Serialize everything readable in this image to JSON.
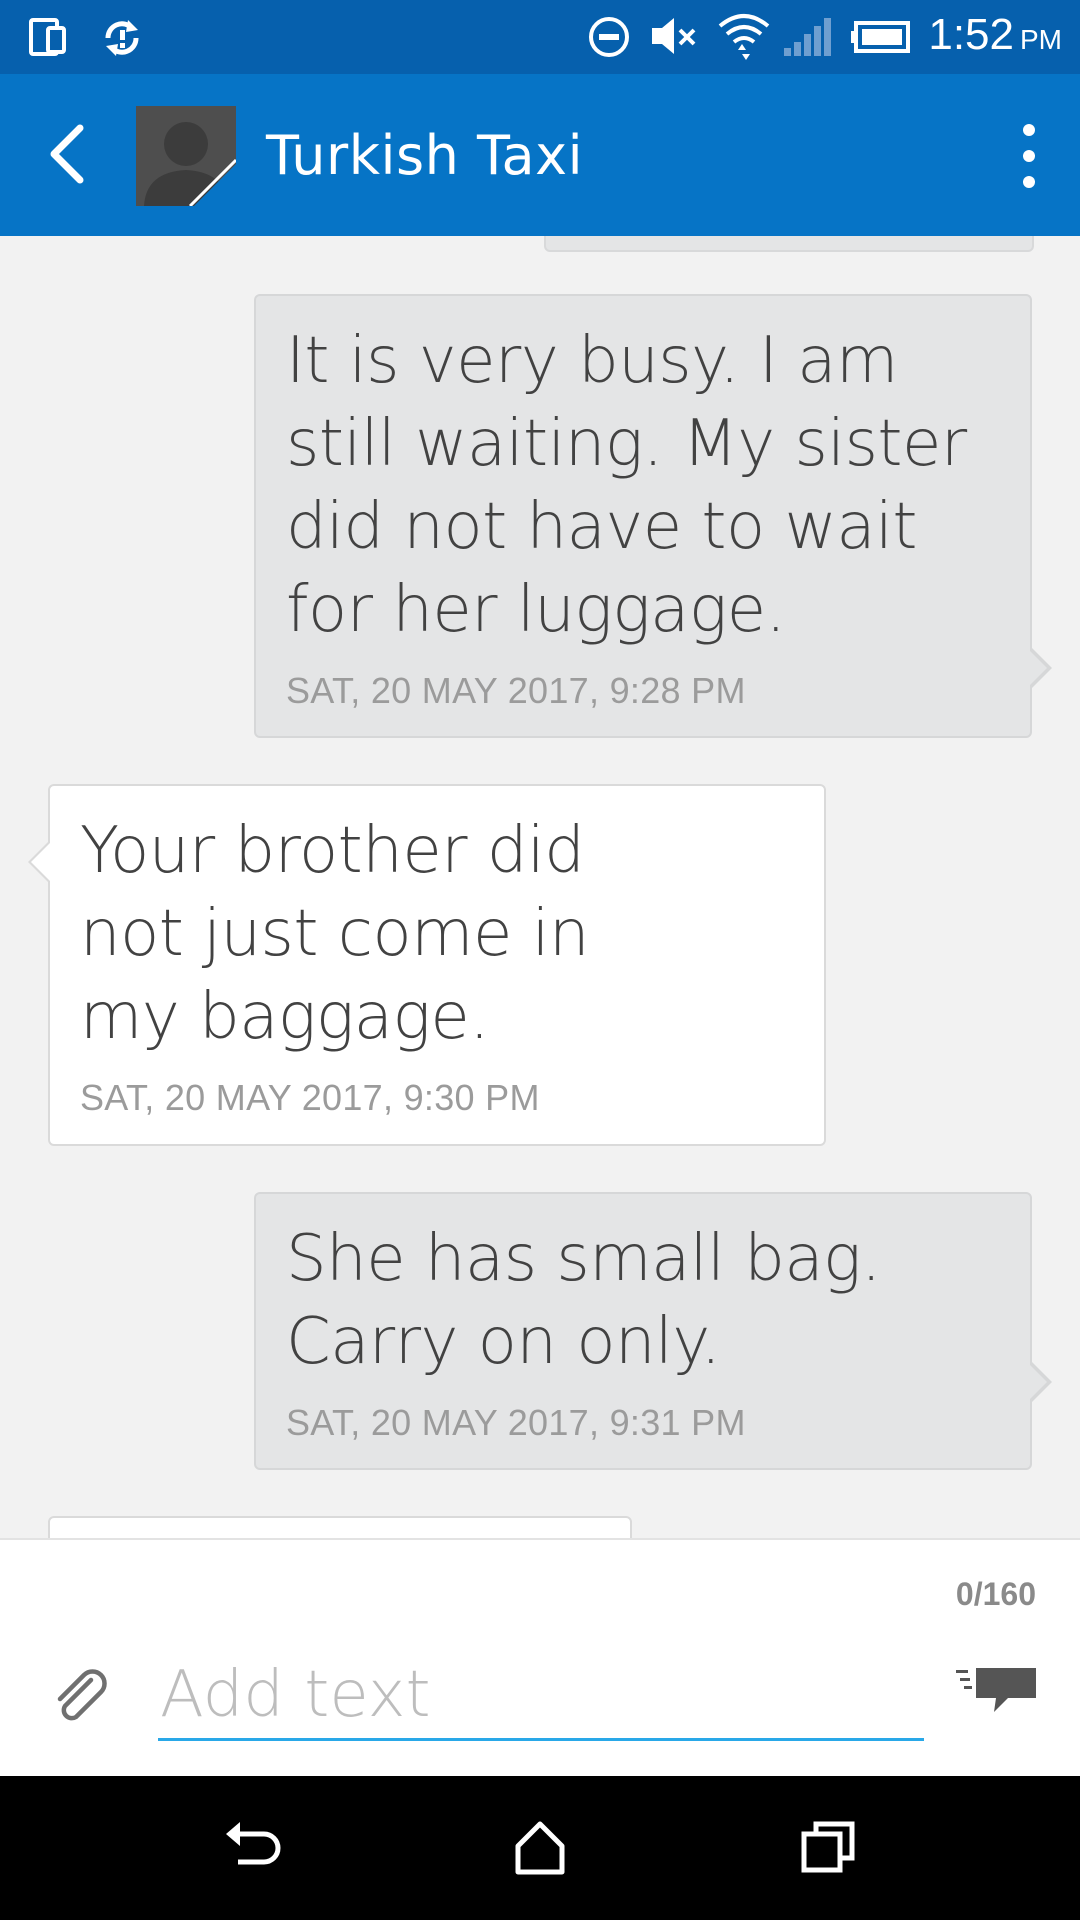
{
  "status_bar": {
    "time": "1:52",
    "ampm": "PM",
    "icons": [
      "phone-tablet-icon",
      "sync-icon",
      "do-not-disturb-icon",
      "mute-icon",
      "wifi-icon",
      "signal-icon",
      "battery-icon"
    ]
  },
  "header": {
    "contact_name": "Turkish Taxi",
    "icons": [
      "back-arrow-icon",
      "contact-avatar",
      "overflow-menu-icon"
    ]
  },
  "messages": [
    {
      "direction": "sent",
      "text": "It is very busy. I am still waiting. My sister did not have to wait for her luggage.",
      "timestamp": "SAT, 20 MAY 2017, 9:28 PM"
    },
    {
      "direction": "received",
      "text": "Your brother did not just come in my baggage.",
      "timestamp": "SAT, 20 MAY 2017, 9:30 PM"
    },
    {
      "direction": "sent",
      "text": "She has small bag. Carry on only.",
      "timestamp": "SAT, 20 MAY 2017, 9:31 PM"
    }
  ],
  "composer": {
    "char_count": "0/160",
    "placeholder": "Add text",
    "value": "",
    "accent_color": "#29a8e8",
    "icons": [
      "paperclip-icon",
      "send-message-icon"
    ]
  },
  "colors": {
    "status_bar": "#0660ad",
    "app_bar": "#0674c6",
    "sent_bubble": "#e4e5e6",
    "received_bubble": "#ffffff",
    "background": "#f2f2f2"
  },
  "nav_bar": {
    "icons": [
      "back-nav-icon",
      "home-nav-icon",
      "recents-nav-icon"
    ]
  }
}
